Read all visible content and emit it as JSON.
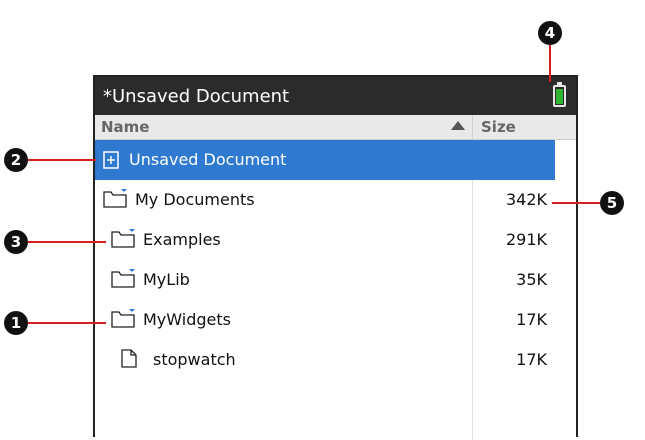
{
  "window": {
    "title": "*Unsaved Document",
    "battery": {
      "level": 0.95,
      "color": "#2fb52f"
    }
  },
  "columns": {
    "name": "Name",
    "size": "Size",
    "sort": "ascending"
  },
  "rows": [
    {
      "label": "Unsaved Document",
      "size": "",
      "icon": "document-plus-icon",
      "selected": true
    },
    {
      "label": "My Documents",
      "size": "342K",
      "icon": "folder-icon",
      "selected": false
    },
    {
      "label": "Examples",
      "size": "291K",
      "icon": "folder-icon",
      "selected": false
    },
    {
      "label": "MyLib",
      "size": "35K",
      "icon": "folder-icon",
      "selected": false
    },
    {
      "label": "MyWidgets",
      "size": "17K",
      "icon": "folder-icon",
      "selected": false
    },
    {
      "label": "stopwatch",
      "size": "17K",
      "icon": "file-icon",
      "selected": false
    }
  ],
  "callouts": [
    "1",
    "2",
    "3",
    "4",
    "5"
  ],
  "colors": {
    "selection": "#2f7ad0",
    "titlebar": "#2b2b2b",
    "callout_line": "#d82020"
  }
}
